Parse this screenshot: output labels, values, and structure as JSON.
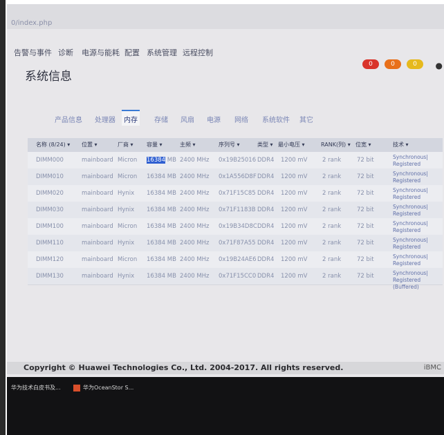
{
  "browser": {
    "url": "0/index.php"
  },
  "menu": [
    {
      "label": "告警与事件"
    },
    {
      "label": "诊断"
    },
    {
      "label": "电源与能耗"
    },
    {
      "label": "配置"
    },
    {
      "label": "系统管理"
    },
    {
      "label": "远程控制"
    }
  ],
  "alerts": [
    {
      "count": "0",
      "color": "#d9342b"
    },
    {
      "count": "0",
      "color": "#e8701a"
    },
    {
      "count": "0",
      "color": "#e6b91d"
    }
  ],
  "page": {
    "title": "系统信息"
  },
  "tabs": [
    {
      "label": "产品信息"
    },
    {
      "label": "处理器"
    },
    {
      "label": "内存"
    },
    {
      "label": "存储"
    },
    {
      "label": "风扇"
    },
    {
      "label": "电源"
    },
    {
      "label": "网络"
    },
    {
      "label": "系统软件"
    },
    {
      "label": "其它"
    }
  ],
  "table": {
    "headers": [
      "名称 (8/24) ▾",
      "位置 ▾",
      "厂商 ▾",
      "容量 ▾",
      "主频 ▾",
      "序列号 ▾",
      "类型 ▾",
      "最小电压 ▾",
      "RANK(列) ▾",
      "位宽 ▾",
      "技术 ▾"
    ],
    "rows": [
      [
        "DIMM000",
        "mainboard",
        "Micron",
        "16384",
        " MB",
        "2400 MHz",
        "0x19B25016",
        "DDR4",
        "1200 mV",
        "2 rank",
        "72 bit",
        "Synchronous| Registered (Buffered)"
      ],
      [
        "DIMM010",
        "mainboard",
        "Micron",
        "16384 MB",
        "",
        "2400 MHz",
        "0x1A556D8F",
        "DDR4",
        "1200 mV",
        "2 rank",
        "72 bit",
        "Synchronous| Registered (Buffered)"
      ],
      [
        "DIMM020",
        "mainboard",
        "Hynix",
        "16384 MB",
        "",
        "2400 MHz",
        "0x71F15C85",
        "DDR4",
        "1200 mV",
        "2 rank",
        "72 bit",
        "Synchronous| Registered (Buffered)"
      ],
      [
        "DIMM030",
        "mainboard",
        "Hynix",
        "16384 MB",
        "",
        "2400 MHz",
        "0x71F1183B",
        "DDR4",
        "1200 mV",
        "2 rank",
        "72 bit",
        "Synchronous| Registered (Buffered)"
      ],
      [
        "DIMM100",
        "mainboard",
        "Micron",
        "16384 MB",
        "",
        "2400 MHz",
        "0x19B34D8C",
        "DDR4",
        "1200 mV",
        "2 rank",
        "72 bit",
        "Synchronous| Registered (Buffered)"
      ],
      [
        "DIMM110",
        "mainboard",
        "Hynix",
        "16384 MB",
        "",
        "2400 MHz",
        "0x71F87A55",
        "DDR4",
        "1200 mV",
        "2 rank",
        "72 bit",
        "Synchronous| Registered (Buffered)"
      ],
      [
        "DIMM120",
        "mainboard",
        "Micron",
        "16384 MB",
        "",
        "2400 MHz",
        "0x19B24AE6",
        "DDR4",
        "1200 mV",
        "2 rank",
        "72 bit",
        "Synchronous| Registered (Buffered)"
      ],
      [
        "DIMM130",
        "mainboard",
        "Hynix",
        "16384 MB",
        "",
        "2400 MHz",
        "0x71F15CC0",
        "DDR4",
        "1200 mV",
        "2 rank",
        "72 bit",
        "Synchronous| Registered (Buffered)"
      ]
    ]
  },
  "footer": {
    "copyright": "Copyright © Huawei Technologies Co., Ltd. 2004-2017. All rights reserved.",
    "brand": "iBMC"
  },
  "taskbar": [
    {
      "label": "华为技术白皮书及..."
    },
    {
      "label": "华为OceanStor S..."
    }
  ]
}
